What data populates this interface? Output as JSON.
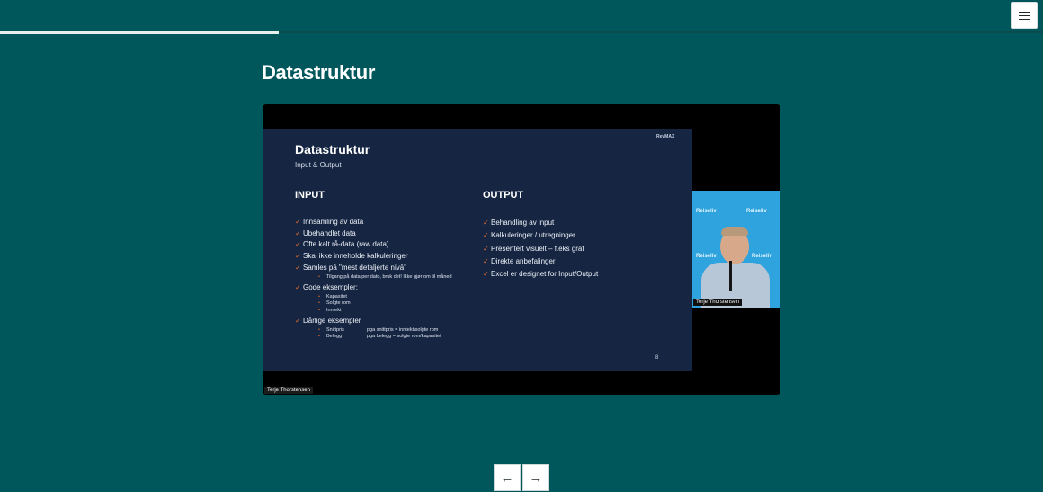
{
  "progress": {
    "fraction": 0.267
  },
  "menu": {
    "icon": "hamburger-menu-icon"
  },
  "page": {
    "title": "Datastruktur"
  },
  "video": {
    "speaker_label": "Terje Thorstensen",
    "slide": {
      "logo": "RevMAX",
      "title": "Datastruktur",
      "subtitle": "Input & Output",
      "input_heading": "INPUT",
      "output_heading": "OUTPUT",
      "input_items": [
        {
          "text": "Innsamling av data"
        },
        {
          "text": "Ubehandlet data"
        },
        {
          "text": "Ofte kalt rå-data (raw data)"
        },
        {
          "text": "Skal ikke inneholde kalkuleringer"
        },
        {
          "text": "Samles på \"mest detaljerte nivå\"",
          "sub": [
            "Tilgang på data per dato, bruk det! Ikke gjør om til måned"
          ]
        },
        {
          "text": "Gode eksempler:",
          "sub": [
            "Kapasitet",
            "Solgte rom",
            "Inntekt"
          ]
        },
        {
          "text": "Dårlige eksempler",
          "sub2": [
            {
              "a": "Snittpris",
              "b": "pga snittpris = inntekt/solgte rom"
            },
            {
              "a": "Belegg",
              "b": "pga belegg = solgte rom/kapasitet"
            }
          ]
        }
      ],
      "output_items": [
        "Behandling av input",
        "Kalkuleringer / utregninger",
        "Presentert visuelt – f.eks graf",
        "Direkte anbefalinger",
        "Excel er designet for Input/Output"
      ],
      "page_number": "8"
    },
    "camera": {
      "name_label": "Terje Thorstensen",
      "logo_text": "Reiseliv",
      "background_color": "#2fa3dd"
    }
  },
  "nav": {
    "prev_label": "←",
    "next_label": "→"
  },
  "colors": {
    "background": "#00575b",
    "slide_bg": "#152542",
    "check": "#e36b2c"
  }
}
